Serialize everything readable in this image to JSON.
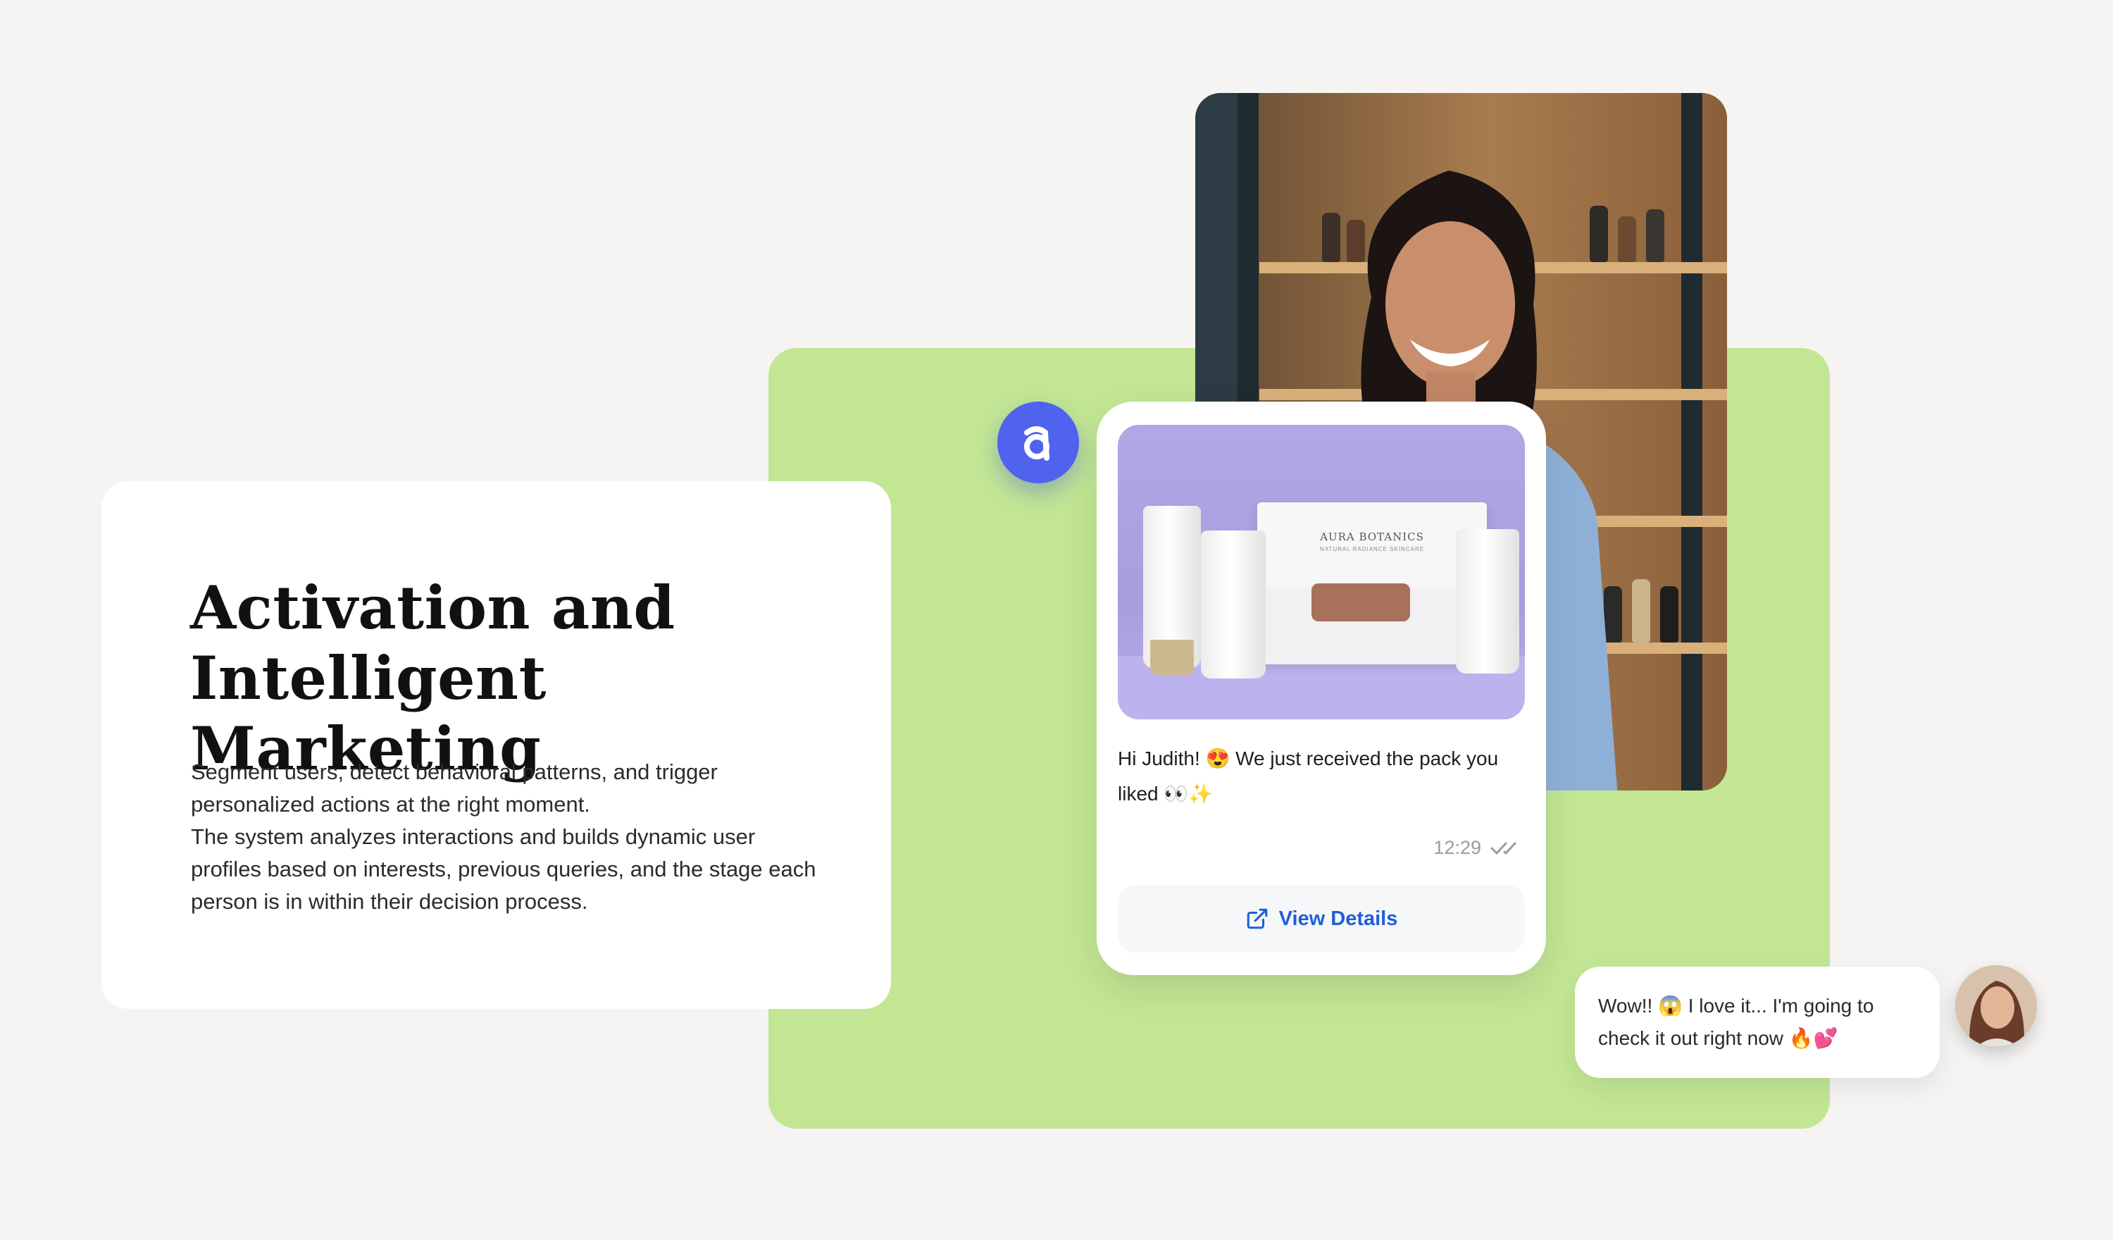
{
  "hero": {
    "title_line1": "Activation and",
    "title_line2": "Intelligent Marketing",
    "description_line1": "Segment users, detect behavioral patterns, and trigger personalized actions at the right moment.",
    "description_line2": "The system analyzes interactions and builds dynamic user profiles based on interests, previous queries, and the stage each person is in within their decision process."
  },
  "brand_badge": {
    "letter": "a",
    "color": "#4f63ee"
  },
  "product_image": {
    "box_brand": "AURA BOTANICS",
    "box_subtitle": "NATURAL RADIANCE SKINCARE",
    "background": "#b2a6e4"
  },
  "chat_message": {
    "text": "Hi Judith! 😍 We just received the pack you liked 👀✨",
    "time": "12:29",
    "read_icon": "double-check-icon",
    "button_label": "View Details",
    "button_icon": "external-link-icon"
  },
  "reply": {
    "text": "Wow!! 😱 I love it... I'm going to check it out right now 🔥💕"
  },
  "colors": {
    "page_background": "#f5f4f2",
    "panel_green": "#c2e694",
    "link_blue": "#1f5fd6"
  }
}
